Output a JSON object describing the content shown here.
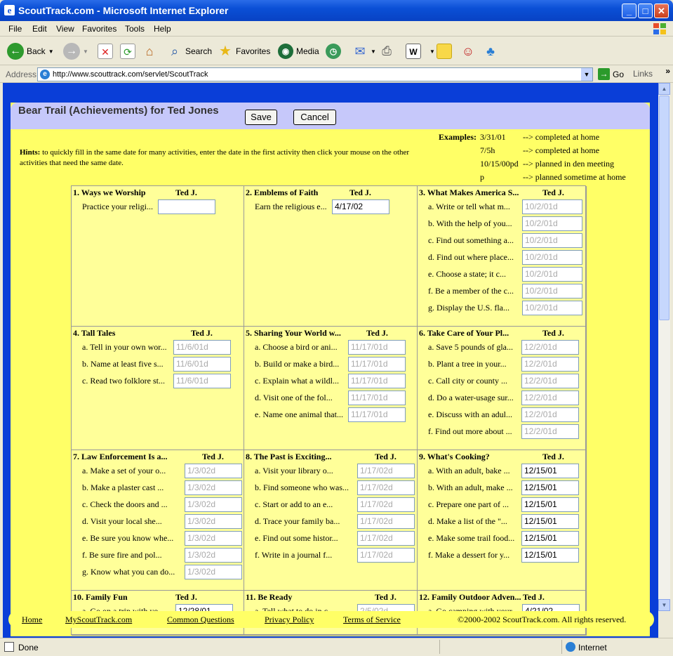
{
  "window": {
    "title": "ScoutTrack.com - Microsoft Internet Explorer"
  },
  "menu": [
    "File",
    "Edit",
    "View",
    "Favorites",
    "Tools",
    "Help"
  ],
  "toolbar": {
    "back": "Back",
    "search": "Search",
    "favorites": "Favorites",
    "media": "Media"
  },
  "address": {
    "label": "Address",
    "url": "http://www.scouttrack.com/servlet/ScoutTrack",
    "go": "Go",
    "links": "Links"
  },
  "page": {
    "title": "Bear Trail (Achievements) for Ted Jones",
    "save": "Save",
    "cancel": "Cancel",
    "hints_label": "Hints:",
    "hints_text": "to quickly fill in the same date for many activities, enter the date in the first activity then click your mouse on the other activities that need the same date."
  },
  "examples": {
    "label": "Examples:",
    "rows": [
      {
        "code": "3/31/01",
        "desc": "--> completed at home"
      },
      {
        "code": "7/5h",
        "desc": "--> completed at home"
      },
      {
        "code": "10/15/00pd",
        "desc": "--> planned in den meeting"
      },
      {
        "code": "p",
        "desc": "--> planned sometime at home"
      }
    ]
  },
  "achievements": [
    {
      "title": "1. Ways we Worship",
      "scout": "Ted J.",
      "items": [
        {
          "label": "Practice your religi...",
          "value": "",
          "ph": ""
        }
      ]
    },
    {
      "title": "2. Emblems of Faith",
      "scout": "Ted J.",
      "items": [
        {
          "label": "Earn the religious e...",
          "value": "4/17/02",
          "ph": ""
        }
      ]
    },
    {
      "title": "3. What Makes America S...",
      "scout": "Ted J.",
      "items": [
        {
          "label": "a. Write or tell what m...",
          "value": "",
          "ph": "10/2/01d"
        },
        {
          "label": "b. With the help of you...",
          "value": "",
          "ph": "10/2/01d"
        },
        {
          "label": "c. Find out something a...",
          "value": "",
          "ph": "10/2/01d"
        },
        {
          "label": "d. Find out where place...",
          "value": "",
          "ph": "10/2/01d"
        },
        {
          "label": "e. Choose a state; it c...",
          "value": "",
          "ph": "10/2/01d"
        },
        {
          "label": "f. Be a member of the c...",
          "value": "",
          "ph": "10/2/01d"
        },
        {
          "label": "g. Display the U.S. fla...",
          "value": "",
          "ph": "10/2/01d"
        }
      ]
    },
    {
      "title": "4. Tall Tales",
      "scout": "Ted J.",
      "items": [
        {
          "label": "a. Tell in your own wor...",
          "value": "",
          "ph": "11/6/01d"
        },
        {
          "label": "b. Name at least five s...",
          "value": "",
          "ph": "11/6/01d"
        },
        {
          "label": "c. Read two folklore st...",
          "value": "",
          "ph": "11/6/01d"
        }
      ]
    },
    {
      "title": "5. Sharing Your World w...",
      "scout": "Ted J.",
      "items": [
        {
          "label": "a. Choose a bird or ani...",
          "value": "",
          "ph": "11/17/01d"
        },
        {
          "label": "b. Build or make a bird...",
          "value": "",
          "ph": "11/17/01d"
        },
        {
          "label": "c. Explain what a wildl...",
          "value": "",
          "ph": "11/17/01d"
        },
        {
          "label": "d. Visit one of the fol...",
          "value": "",
          "ph": "11/17/01d"
        },
        {
          "label": "e. Name one animal that...",
          "value": "",
          "ph": "11/17/01d"
        }
      ]
    },
    {
      "title": "6. Take Care of Your Pl...",
      "scout": "Ted J.",
      "items": [
        {
          "label": "a. Save 5 pounds of gla...",
          "value": "",
          "ph": "12/2/01d"
        },
        {
          "label": "b. Plant a tree in your...",
          "value": "",
          "ph": "12/2/01d"
        },
        {
          "label": "c. Call city or county ...",
          "value": "",
          "ph": "12/2/01d"
        },
        {
          "label": "d. Do a water-usage sur...",
          "value": "",
          "ph": "12/2/01d"
        },
        {
          "label": "e. Discuss with an adul...",
          "value": "",
          "ph": "12/2/01d"
        },
        {
          "label": "f. Find out more about ...",
          "value": "",
          "ph": "12/2/01d"
        }
      ]
    },
    {
      "title": "7. Law Enforcement Is a...",
      "scout": "Ted J.",
      "items": [
        {
          "label": "a. Make a set of your o...",
          "value": "",
          "ph": "1/3/02d"
        },
        {
          "label": "b. Make a plaster cast ...",
          "value": "",
          "ph": "1/3/02d"
        },
        {
          "label": "c. Check the doors and ...",
          "value": "",
          "ph": "1/3/02d"
        },
        {
          "label": "d. Visit your local she...",
          "value": "",
          "ph": "1/3/02d"
        },
        {
          "label": "e. Be sure you know whe...",
          "value": "",
          "ph": "1/3/02d"
        },
        {
          "label": "f. Be sure fire and pol...",
          "value": "",
          "ph": "1/3/02d"
        },
        {
          "label": "g. Know what you can do...",
          "value": "",
          "ph": "1/3/02d"
        }
      ]
    },
    {
      "title": "8. The Past is Exciting...",
      "scout": "Ted J.",
      "items": [
        {
          "label": "a. Visit your library o...",
          "value": "",
          "ph": "1/17/02d"
        },
        {
          "label": "b. Find someone who was...",
          "value": "",
          "ph": "1/17/02d"
        },
        {
          "label": "c. Start or add to an e...",
          "value": "",
          "ph": "1/17/02d"
        },
        {
          "label": "d. Trace your family ba...",
          "value": "",
          "ph": "1/17/02d"
        },
        {
          "label": "e. Find out some histor...",
          "value": "",
          "ph": "1/17/02d"
        },
        {
          "label": "f. Write in a journal f...",
          "value": "",
          "ph": "1/17/02d"
        }
      ]
    },
    {
      "title": "9. What's Cooking?",
      "scout": "Ted J.",
      "items": [
        {
          "label": "a. With an adult, bake ...",
          "value": "12/15/01",
          "ph": ""
        },
        {
          "label": "b. With an adult, make ...",
          "value": "12/15/01",
          "ph": ""
        },
        {
          "label": "c. Prepare one part of ...",
          "value": "12/15/01",
          "ph": ""
        },
        {
          "label": "d. Make a list of the \"...",
          "value": "12/15/01",
          "ph": ""
        },
        {
          "label": "e. Make some trail food...",
          "value": "12/15/01",
          "ph": ""
        },
        {
          "label": "f. Make a dessert for y...",
          "value": "12/15/01",
          "ph": ""
        }
      ]
    },
    {
      "title": "10. Family Fun",
      "scout": "Ted J.",
      "items": [
        {
          "label": "a. Go on a trip with yo...",
          "value": "12/28/01",
          "ph": ""
        }
      ]
    },
    {
      "title": "11. Be Ready",
      "scout": "Ted J.",
      "items": [
        {
          "label": "a. Tell what to do in c...",
          "value": "",
          "ph": "2/5/02d"
        }
      ]
    },
    {
      "title": "12. Family Outdoor Adven...",
      "scout": "Ted J.",
      "items": [
        {
          "label": "a. Go camping with your...",
          "value": "4/21/02",
          "ph": ""
        }
      ]
    }
  ],
  "footer": {
    "home": "Home",
    "my": "MyScoutTrack.com",
    "questions": "Common Questions",
    "privacy": "Privacy Policy",
    "terms": "Terms of Service",
    "copyright": "©2000-2002 ScoutTrack.com. All rights reserved."
  },
  "status": {
    "text": "Done",
    "zone": "Internet"
  }
}
